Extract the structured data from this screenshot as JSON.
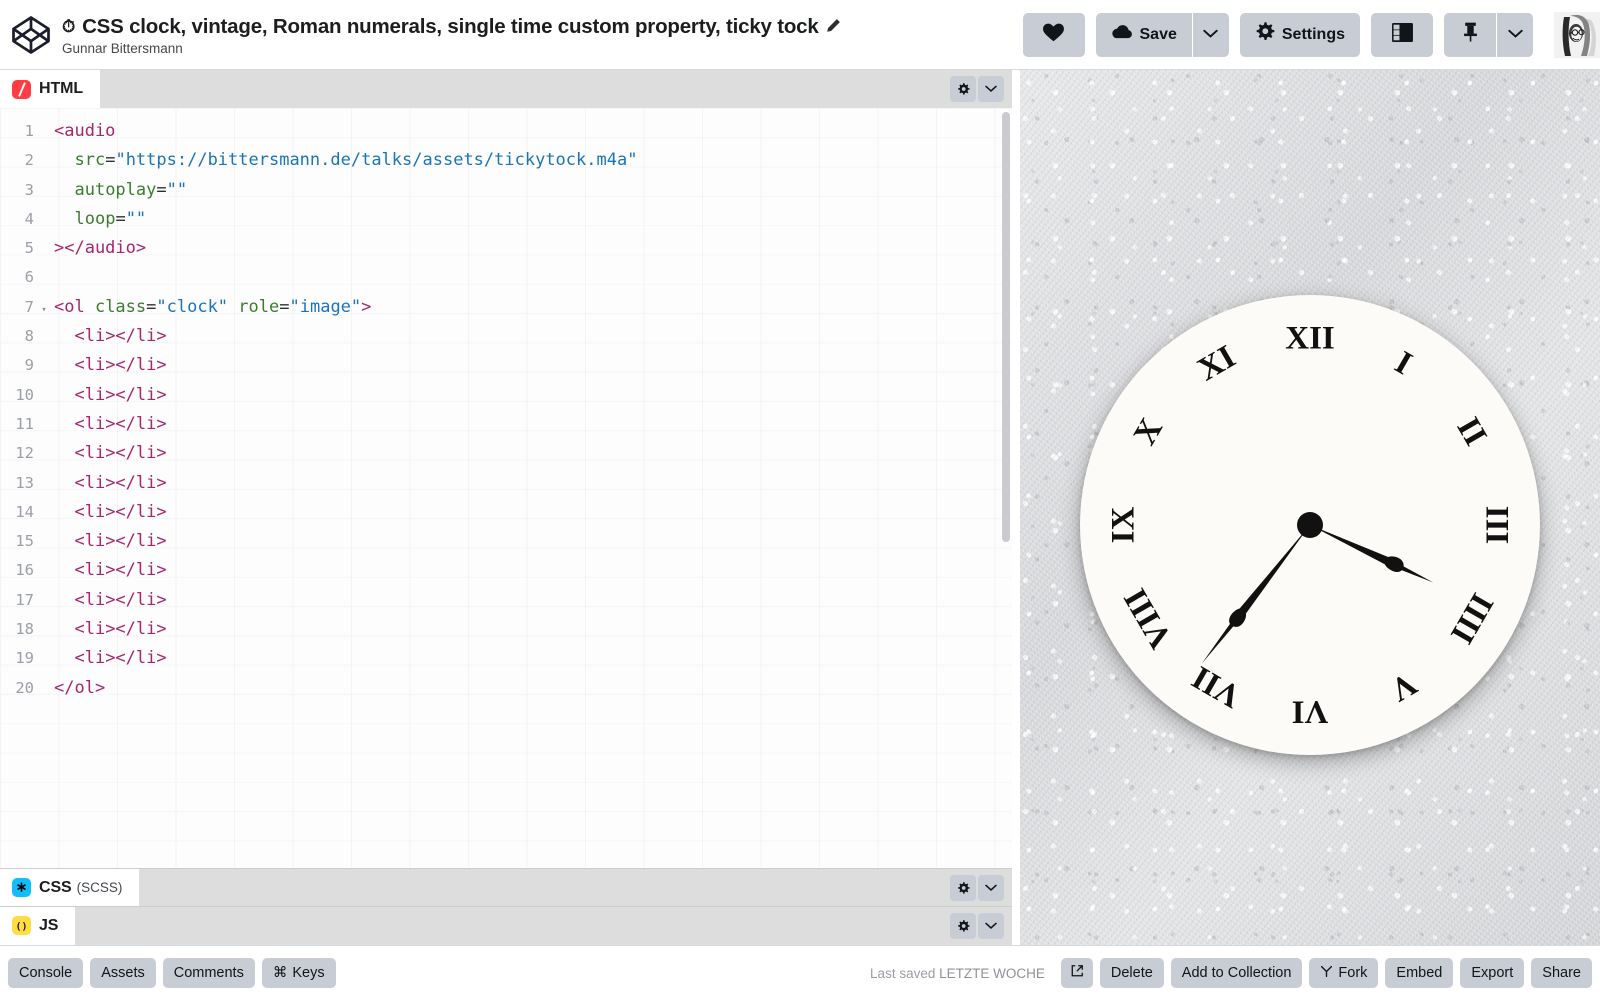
{
  "topbar": {
    "logo_icon": "codepen-logo-icon",
    "pen_emoji": "⏱",
    "pen_title": "CSS clock, vintage, Roman numerals, single time custom property, ticky tock",
    "edit_icon": "pencil-icon",
    "author": "Gunnar Bittersmann",
    "actions": {
      "love_icon": "heart-icon",
      "save_label": "Save",
      "save_icon": "cloud-icon",
      "save_caret_icon": "chevron-down-icon",
      "settings_label": "Settings",
      "settings_icon": "gear-icon",
      "layout_icon": "layout-panels-icon",
      "pin_icon": "pin-icon",
      "pin_caret_icon": "chevron-down-icon",
      "avatar_icon": "user-avatar"
    }
  },
  "editors": {
    "panes": [
      {
        "lang": "HTML",
        "lang_short": "/",
        "sublabel": "",
        "settings_icon": "gear-icon",
        "collapse_icon": "chevron-down-icon"
      },
      {
        "lang": "CSS",
        "lang_short": "*",
        "sublabel": "(SCSS)",
        "settings_icon": "gear-icon",
        "collapse_icon": "chevron-down-icon"
      },
      {
        "lang": "JS",
        "lang_short": "()",
        "sublabel": "",
        "settings_icon": "gear-icon",
        "collapse_icon": "chevron-down-icon"
      }
    ],
    "html_code": [
      {
        "n": "1",
        "fold": "",
        "tokens": [
          {
            "t": "tag",
            "v": "<audio"
          }
        ]
      },
      {
        "n": "2",
        "fold": "",
        "tokens": [
          {
            "t": "plain",
            "v": "  "
          },
          {
            "t": "attr",
            "v": "src"
          },
          {
            "t": "op",
            "v": "="
          },
          {
            "t": "str",
            "v": "\"https://bittersmann.de/talks/assets/tickytock.m4a\""
          }
        ]
      },
      {
        "n": "3",
        "fold": "",
        "tokens": [
          {
            "t": "plain",
            "v": "  "
          },
          {
            "t": "attr",
            "v": "autoplay"
          },
          {
            "t": "op",
            "v": "="
          },
          {
            "t": "str",
            "v": "\"\""
          }
        ]
      },
      {
        "n": "4",
        "fold": "",
        "tokens": [
          {
            "t": "plain",
            "v": "  "
          },
          {
            "t": "attr",
            "v": "loop"
          },
          {
            "t": "op",
            "v": "="
          },
          {
            "t": "str",
            "v": "\"\""
          }
        ]
      },
      {
        "n": "5",
        "fold": "",
        "tokens": [
          {
            "t": "tag",
            "v": "></audio>"
          }
        ]
      },
      {
        "n": "6",
        "fold": "",
        "tokens": []
      },
      {
        "n": "7",
        "fold": "▾",
        "tokens": [
          {
            "t": "tag",
            "v": "<ol "
          },
          {
            "t": "attr",
            "v": "class"
          },
          {
            "t": "op",
            "v": "="
          },
          {
            "t": "str",
            "v": "\"clock\""
          },
          {
            "t": "plain",
            "v": " "
          },
          {
            "t": "attr",
            "v": "role"
          },
          {
            "t": "op",
            "v": "="
          },
          {
            "t": "str",
            "v": "\"image\""
          },
          {
            "t": "tag",
            "v": ">"
          }
        ]
      },
      {
        "n": "8",
        "fold": "",
        "tokens": [
          {
            "t": "plain",
            "v": "  "
          },
          {
            "t": "tag",
            "v": "<li></li>"
          }
        ]
      },
      {
        "n": "9",
        "fold": "",
        "tokens": [
          {
            "t": "plain",
            "v": "  "
          },
          {
            "t": "tag",
            "v": "<li></li>"
          }
        ]
      },
      {
        "n": "10",
        "fold": "",
        "tokens": [
          {
            "t": "plain",
            "v": "  "
          },
          {
            "t": "tag",
            "v": "<li></li>"
          }
        ]
      },
      {
        "n": "11",
        "fold": "",
        "tokens": [
          {
            "t": "plain",
            "v": "  "
          },
          {
            "t": "tag",
            "v": "<li></li>"
          }
        ]
      },
      {
        "n": "12",
        "fold": "",
        "tokens": [
          {
            "t": "plain",
            "v": "  "
          },
          {
            "t": "tag",
            "v": "<li></li>"
          }
        ]
      },
      {
        "n": "13",
        "fold": "",
        "tokens": [
          {
            "t": "plain",
            "v": "  "
          },
          {
            "t": "tag",
            "v": "<li></li>"
          }
        ]
      },
      {
        "n": "14",
        "fold": "",
        "tokens": [
          {
            "t": "plain",
            "v": "  "
          },
          {
            "t": "tag",
            "v": "<li></li>"
          }
        ]
      },
      {
        "n": "15",
        "fold": "",
        "tokens": [
          {
            "t": "plain",
            "v": "  "
          },
          {
            "t": "tag",
            "v": "<li></li>"
          }
        ]
      },
      {
        "n": "16",
        "fold": "",
        "tokens": [
          {
            "t": "plain",
            "v": "  "
          },
          {
            "t": "tag",
            "v": "<li></li>"
          }
        ]
      },
      {
        "n": "17",
        "fold": "",
        "tokens": [
          {
            "t": "plain",
            "v": "  "
          },
          {
            "t": "tag",
            "v": "<li></li>"
          }
        ]
      },
      {
        "n": "18",
        "fold": "",
        "tokens": [
          {
            "t": "plain",
            "v": "  "
          },
          {
            "t": "tag",
            "v": "<li></li>"
          }
        ]
      },
      {
        "n": "19",
        "fold": "",
        "tokens": [
          {
            "t": "plain",
            "v": "  "
          },
          {
            "t": "tag",
            "v": "<li></li>"
          }
        ]
      },
      {
        "n": "20",
        "fold": "",
        "tokens": [
          {
            "t": "tag",
            "v": "</ol>"
          }
        ]
      }
    ]
  },
  "preview": {
    "background": "textured-white-plaster-wall",
    "clock": {
      "face_color": "#fdfbf7",
      "hand_color": "#111111",
      "numerals": [
        {
          "label": "XII",
          "hour": 12
        },
        {
          "label": "I",
          "hour": 1
        },
        {
          "label": "II",
          "hour": 2
        },
        {
          "label": "III",
          "hour": 3
        },
        {
          "label": "IIII",
          "hour": 4
        },
        {
          "label": "V",
          "hour": 5
        },
        {
          "label": "VI",
          "hour": 6
        },
        {
          "label": "VII",
          "hour": 7
        },
        {
          "label": "VIII",
          "hour": 8
        },
        {
          "label": "IX",
          "hour": 9
        },
        {
          "label": "X",
          "hour": 10
        },
        {
          "label": "XI",
          "hour": 11
        }
      ],
      "time": {
        "hour_hand_deg": 115,
        "minute_hand_deg": 218
      }
    }
  },
  "bottombar": {
    "left_buttons": [
      {
        "label": "Console",
        "icon": ""
      },
      {
        "label": "Assets",
        "icon": ""
      },
      {
        "label": "Comments",
        "icon": ""
      },
      {
        "label": "Keys",
        "icon": "⌘"
      }
    ],
    "last_saved_prefix": "Last saved",
    "last_saved_value": "LETZTE WOCHE",
    "right_buttons": [
      {
        "label": "",
        "icon": "external-link-icon"
      },
      {
        "label": "Delete",
        "icon": ""
      },
      {
        "label": "Add to Collection",
        "icon": ""
      },
      {
        "label": "Fork",
        "icon": "fork-icon"
      },
      {
        "label": "Embed",
        "icon": ""
      },
      {
        "label": "Export",
        "icon": ""
      },
      {
        "label": "Share",
        "icon": ""
      }
    ]
  }
}
